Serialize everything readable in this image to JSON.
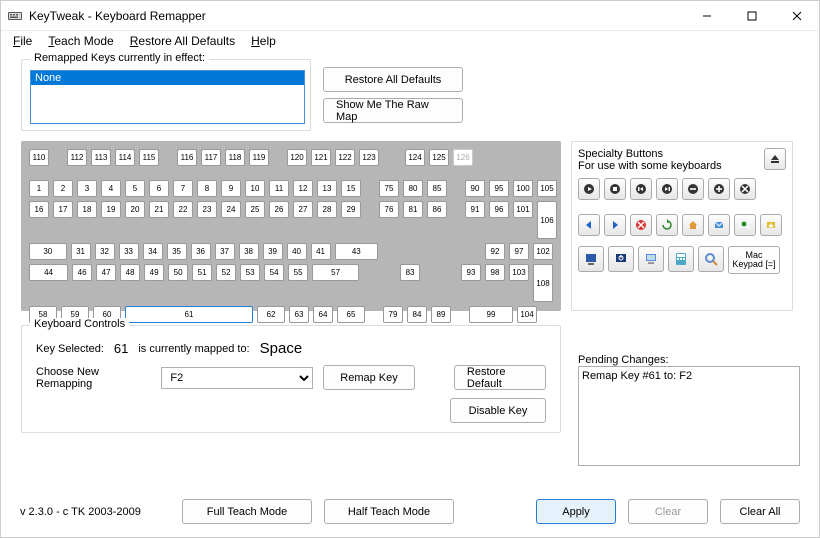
{
  "window": {
    "title": "KeyTweak -  Keyboard Remapper"
  },
  "menu": {
    "file": "File",
    "teach": "Teach Mode",
    "restore": "Restore All Defaults",
    "help": "Help"
  },
  "remapped": {
    "legend": "Remapped Keys currently in effect:",
    "item": "None",
    "restoreAll": "Restore All Defaults",
    "showRaw": "Show Me The Raw Map"
  },
  "keyboard": {
    "row0a": [
      "110"
    ],
    "row0b": [
      "112",
      "113",
      "114",
      "115"
    ],
    "row0c": [
      "116",
      "117",
      "118",
      "119"
    ],
    "row0d": [
      "120",
      "121",
      "122",
      "123"
    ],
    "row0e": [
      "124",
      "125",
      "126"
    ],
    "row1main": [
      "1",
      "2",
      "3",
      "4",
      "5",
      "6",
      "7",
      "8",
      "9",
      "10",
      "11",
      "12",
      "13",
      "15"
    ],
    "row1nav": [
      "75",
      "80",
      "85"
    ],
    "row1num": [
      "90",
      "95",
      "100",
      "105"
    ],
    "row2main": [
      "16",
      "17",
      "18",
      "19",
      "20",
      "21",
      "22",
      "23",
      "24",
      "25",
      "26",
      "27",
      "28",
      "29"
    ],
    "row2nav": [
      "76",
      "81",
      "86"
    ],
    "row2num": [
      "91",
      "96",
      "101"
    ],
    "row2numTall": "106",
    "row3main": [
      "30",
      "31",
      "32",
      "33",
      "34",
      "35",
      "36",
      "37",
      "38",
      "39",
      "40",
      "41",
      "43"
    ],
    "row3num": [
      "92",
      "97",
      "102"
    ],
    "row4main": [
      "44",
      "46",
      "47",
      "48",
      "49",
      "50",
      "51",
      "52",
      "53",
      "54",
      "55",
      "57"
    ],
    "row4nav": "83",
    "row4num": [
      "93",
      "98",
      "103"
    ],
    "row4numTall": "108",
    "row5main": [
      "58",
      "59",
      "60",
      "61",
      "62",
      "63",
      "64",
      "65"
    ],
    "row5nav": [
      "79",
      "84",
      "89"
    ],
    "row5num": [
      "99",
      "104"
    ],
    "selectedKey": "61"
  },
  "specialty": {
    "title": "Specialty Buttons",
    "sub": "For use with some keyboards",
    "mac1": "Mac",
    "mac2": "Keypad [=]"
  },
  "controls": {
    "legend": "Keyboard Controls",
    "keySelected": "Key Selected:",
    "keyNum": "61",
    "curMappedTo": "is currently mapped to:",
    "mappedValue": "Space",
    "chooseNew": "Choose New Remapping",
    "dropValue": "F2",
    "remapKey": "Remap Key",
    "restoreDefault": "Restore Default",
    "disableKey": "Disable Key"
  },
  "pending": {
    "label": "Pending Changes:",
    "item": "Remap Key #61 to: F2"
  },
  "bottom": {
    "version": "v 2.3.0 - c TK 2003-2009",
    "fullTeach": "Full Teach Mode",
    "halfTeach": "Half Teach Mode",
    "apply": "Apply",
    "clear": "Clear",
    "clearAll": "Clear All"
  }
}
